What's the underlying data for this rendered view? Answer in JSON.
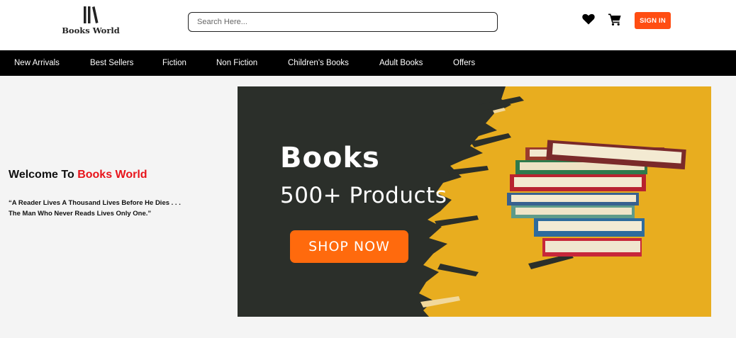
{
  "header": {
    "logo_text": "Books World",
    "search_placeholder": "Search Here...",
    "wishlist_icon": "heart-icon",
    "cart_icon": "cart-icon",
    "signin_label": "SIGN IN",
    "signin_color": "#ff4d12"
  },
  "nav": {
    "items": [
      "New Arrivals",
      "Best Sellers",
      "Fiction",
      "Non Fiction",
      "Children's Books",
      "Adult Books",
      "Offers"
    ]
  },
  "hero": {
    "welcome_prefix": "Welcome To ",
    "welcome_brand": "Books World",
    "brand_color": "#e8141b",
    "quote_line1": "“A Reader Lives A Thousand Lives Before He Dies . . .",
    "quote_line2": "The Man Who Never Reads Lives Only One.”"
  },
  "banner": {
    "title": "Books",
    "subtitle": "500+ Products",
    "cta_label": "SHOP NOW",
    "cta_color": "#ff6a0d"
  }
}
